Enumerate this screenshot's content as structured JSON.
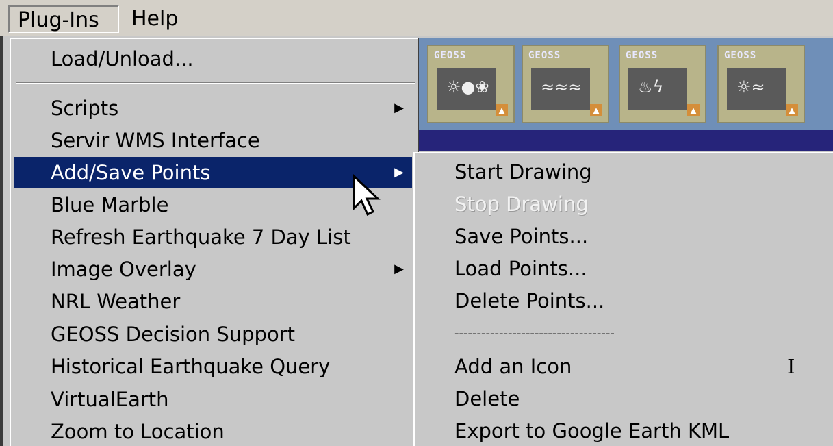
{
  "menubar": {
    "items": [
      {
        "label": "Plug-Ins",
        "active": true
      },
      {
        "label": "Help",
        "active": false
      }
    ]
  },
  "banner": {
    "tiles": [
      {
        "title": "GEOSS",
        "glyph": "☼●❀"
      },
      {
        "title": "GEOSS",
        "glyph": "≈≈≈"
      },
      {
        "title": "GEOSS",
        "glyph": "♨ϟ"
      },
      {
        "title": "GEOSS",
        "glyph": "☼≈"
      }
    ],
    "badge_glyph": "▲"
  },
  "plugins_menu": {
    "items": [
      {
        "label": "Load/Unload...",
        "submenu": false
      },
      {
        "label": "Scripts",
        "submenu": true
      },
      {
        "label": "Servir WMS Interface",
        "submenu": false
      },
      {
        "label": "Add/Save Points",
        "submenu": true,
        "highlighted": true
      },
      {
        "label": "Blue Marble",
        "submenu": false
      },
      {
        "label": "Refresh Earthquake 7 Day List",
        "submenu": false
      },
      {
        "label": "Image Overlay",
        "submenu": true
      },
      {
        "label": "NRL Weather",
        "submenu": false
      },
      {
        "label": "GEOSS Decision Support",
        "submenu": false
      },
      {
        "label": "Historical Earthquake Query",
        "submenu": false
      },
      {
        "label": "VirtualEarth",
        "submenu": false
      },
      {
        "label": "Zoom to Location",
        "submenu": false
      }
    ],
    "arrow_glyph": "▶"
  },
  "add_save_points_submenu": {
    "items": [
      {
        "label": "Start Drawing",
        "enabled": true
      },
      {
        "label": "Stop Drawing",
        "enabled": false
      },
      {
        "label": "Save Points...",
        "enabled": true
      },
      {
        "label": "Load Points...",
        "enabled": true
      },
      {
        "label": "Delete Points...",
        "enabled": true
      },
      {
        "label": "------------------------------------",
        "enabled": true
      },
      {
        "label": "Add an Icon",
        "enabled": true,
        "accelerator": "I"
      },
      {
        "label": "Delete",
        "enabled": true
      },
      {
        "label": "Export to Google Earth KML",
        "enabled": true
      }
    ]
  },
  "colors": {
    "menu_bg": "#c8c8c8",
    "highlight_bg": "#0a246a",
    "highlight_fg": "#ffffff",
    "banner_bg": "#6f8fb8",
    "banner_dark": "#26247a",
    "tile_bg": "#b8b48a",
    "badge": "#d48e3a"
  }
}
